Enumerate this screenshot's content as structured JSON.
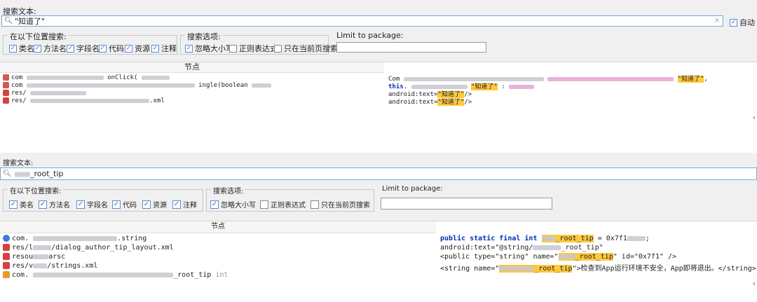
{
  "panel1": {
    "search_label": "搜索文本:",
    "search_value": "\"知道了\"",
    "auto_label": "自动",
    "location_title": "在以下位置搜索:",
    "locations": [
      {
        "label": "类名",
        "checked": true
      },
      {
        "label": "方法名",
        "checked": true
      },
      {
        "label": "字段名",
        "checked": true
      },
      {
        "label": "代码",
        "checked": true
      },
      {
        "label": "资源",
        "checked": true
      },
      {
        "label": "注释",
        "checked": true
      }
    ],
    "options_title": "搜索选项:",
    "options": [
      {
        "label": "忽略大小写",
        "checked": true
      },
      {
        "label": "正则表达式",
        "checked": false
      },
      {
        "label": "只在当前页搜索",
        "checked": false
      }
    ],
    "package_title": "Limit to package:",
    "column_header": "节点",
    "rows": [
      {
        "icon": "class",
        "a": "com",
        "b": "onClick("
      },
      {
        "icon": "class",
        "a": "com",
        "b": "ingle(boolean"
      },
      {
        "icon": "res",
        "a": "res/",
        "b": ""
      },
      {
        "icon": "res",
        "a": "res/",
        "b": ".xml"
      }
    ],
    "code_lines": [
      {
        "pre": "Com",
        "hl": "\"知道了\"",
        "post": ","
      },
      {
        "kw": "this",
        "mid": ".",
        "hl": "\"知道了\"",
        "post": ":"
      },
      {
        "pre": "android:text=",
        "hl": "\"知道了\"",
        "post": "/>"
      },
      {
        "pre": "android:text=",
        "hl": "\"知道了\"",
        "post": "/>"
      }
    ]
  },
  "panel2": {
    "search_label": "搜索文本:",
    "search_value": "_root_tip",
    "location_title": "在以下位置搜索:",
    "locations": [
      {
        "label": "类名",
        "checked": true
      },
      {
        "label": "方法名",
        "checked": true
      },
      {
        "label": "字段名",
        "checked": true
      },
      {
        "label": "代码",
        "checked": true
      },
      {
        "label": "资源",
        "checked": true
      },
      {
        "label": "注释",
        "checked": true
      }
    ],
    "options_title": "搜索选项:",
    "options": [
      {
        "label": "忽略大小写",
        "checked": true
      },
      {
        "label": "正则表达式",
        "checked": false
      },
      {
        "label": "只在当前页搜索",
        "checked": false
      }
    ],
    "package_title": "Limit to package:",
    "column_header": "节点",
    "rows": [
      {
        "icon": "file",
        "a": "com.",
        "b": ".string",
        "c": ""
      },
      {
        "icon": "res",
        "a": "res/l",
        "b": "/dialog_author_tip_layout.xml",
        "c": ""
      },
      {
        "icon": "res",
        "a": "resou",
        "b": "arsc",
        "c": ""
      },
      {
        "icon": "res",
        "a": "res/v",
        "b": "/strings.xml",
        "c": ""
      },
      {
        "icon": "field",
        "a": "com.",
        "b": "_root_tip",
        "c": "int"
      }
    ],
    "code_lines": [
      {
        "kw": "public static final int",
        "mid": "",
        "hl": "_root_tip",
        "post": "= 0x7f1"
      },
      {
        "pre": "android:text=\"@string/",
        "hl": "",
        "post": "_root_tip\""
      },
      {
        "pre": "<public type=\"string\" name=\"",
        "hl": "_root_tip",
        "post": "\" id=\"0x7f1\" />"
      },
      {
        "pre": "<string name=\"",
        "hl": "_root_tip",
        "post": "\">检查到App运行环境不安全，App即将退出。</string>"
      }
    ]
  },
  "colors": {
    "highlight": "#ffc83d",
    "keyword": "#0033b3",
    "accent": "#5b8fd0"
  }
}
